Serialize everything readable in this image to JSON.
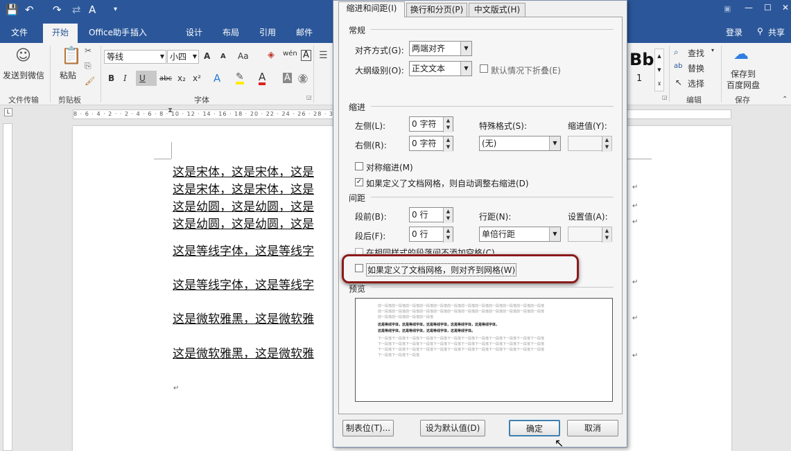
{
  "title_bar": {
    "quick_access": [
      "💾",
      "↶",
      "↷",
      "⇄",
      "A",
      "▾"
    ],
    "tabs": [
      "文件",
      "开始",
      "Office助手",
      "插入",
      "设计",
      "布局",
      "引用",
      "邮件"
    ],
    "right": {
      "login": "登录",
      "share": "共享"
    }
  },
  "ribbon": {
    "wechat": {
      "label": "发送到微信",
      "group": "文件传输"
    },
    "clipboard": {
      "paste": "粘贴",
      "group": "剪贴板"
    },
    "font": {
      "name": "等线",
      "size": "小四",
      "group": "字体",
      "aa": "Aa",
      "wen": "wén",
      "grow": "A",
      "shrink": "A"
    },
    "format_buttons": [
      "B",
      "I",
      "U",
      "abc",
      "x₂",
      "x²"
    ],
    "editing": {
      "find": "查找",
      "replace": "替换",
      "select": "选择",
      "group": "编辑"
    },
    "save": {
      "label1": "保存到",
      "label2": "百度网盘",
      "group": "保存"
    },
    "styles_partial": "Bb",
    "styles_num": "1"
  },
  "ruler_text": "8 · 6 · 4 · 2 · · 2 · 4 · 6 · 8 · 10 · 12 · 14 · 16 · 18 · 20 · 22 · 24 · 26 · 28 · 30 · 32 · 34 · 36 · 38 · 40 · 42 · 44 · 46 · 48 · 50",
  "document": {
    "lines": [
      "这是宋体，这是宋体，这是",
      "这是宋体，这是宋体，这是",
      "这是幼圆，这是幼圆，这是",
      "这是幼圆，这是幼圆，这是",
      "这是等线字体，这是等线字",
      "这是等线字体，这是等线字",
      "这是微软雅黑，这是微软雅",
      "这是微软雅黑，这是微软雅"
    ],
    "para_mark": "↵"
  },
  "dialog": {
    "tabs": [
      "缩进和间距(I)",
      "换行和分页(P)",
      "中文版式(H)"
    ],
    "general": {
      "section": "常规",
      "align_label": "对齐方式(G):",
      "align_value": "两端对齐",
      "outline_label": "大纲级别(O):",
      "outline_value": "正文文本",
      "collapse_label": "默认情况下折叠(E)"
    },
    "indent": {
      "section": "缩进",
      "left_label": "左侧(L):",
      "left_value": "0 字符",
      "right_label": "右侧(R):",
      "right_value": "0 字符",
      "special_label": "特殊格式(S):",
      "special_value": "(无)",
      "by_label": "缩进值(Y):",
      "mirror_label": "对称缩进(M)",
      "auto_adjust_label": "如果定义了文档网格，则自动调整右缩进(D)"
    },
    "spacing": {
      "section": "间距",
      "before_label": "段前(B):",
      "before_value": "0 行",
      "after_label": "段后(F):",
      "after_value": "0 行",
      "line_label": "行距(N):",
      "line_value": "单倍行距",
      "at_label": "设置值(A):",
      "same_style_label": "在相同样式的段落间不添加空格(C)",
      "snap_grid_label": "如果定义了文档网格，则对齐到网格(W)"
    },
    "preview": {
      "section": "预览",
      "gray_line": "前一段落前一段落前一段落前一段落前一段落前一段落前一段落前一段落前一段落前一段落前一段落前一段落",
      "gray_short": "前一段落前一段落前一段落前一段落",
      "sample_line": "这是等线字体，这是等线字体，这是等线字体，这是等线字体，这是等线字体，",
      "sample_short": "这是等线字体，这是等线字体，这是等线字体，这是等线字体。",
      "next_line": "下一段落下一段落下一段落下一段落下一段落下一段落下一段落下一段落下一段落下一段落下一段落下一段落",
      "next_short": "下一段落下一段落下一段落"
    },
    "buttons": {
      "tabs": "制表位(T)...",
      "default": "设为默认值(D)",
      "ok": "确定",
      "cancel": "取消"
    }
  }
}
